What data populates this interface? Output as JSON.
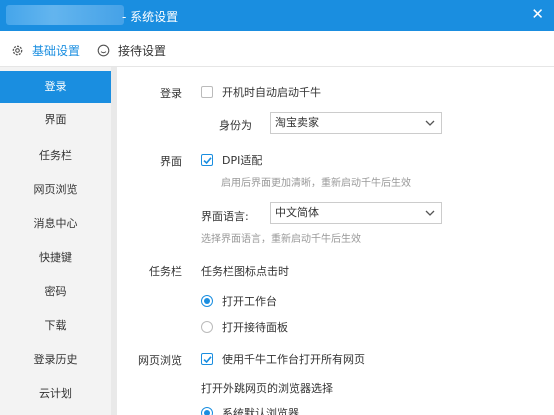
{
  "window": {
    "title": "- 系统设置",
    "close_label": "✕"
  },
  "tabs": [
    {
      "label": "基础设置",
      "icon": "gear-icon",
      "active": true
    },
    {
      "label": "接待设置",
      "icon": "smile-icon",
      "active": false
    }
  ],
  "sidebar": {
    "items": [
      {
        "label": "登录",
        "active": true
      },
      {
        "label": "界面"
      },
      {
        "label": "任务栏"
      },
      {
        "label": "网页浏览"
      },
      {
        "label": "消息中心"
      },
      {
        "label": "快捷键"
      },
      {
        "label": "密码"
      },
      {
        "label": "下载"
      },
      {
        "label": "登录历史"
      },
      {
        "label": "云计划"
      }
    ]
  },
  "login": {
    "section_label": "登录",
    "autostart_label": "开机时自动启动千牛",
    "autostart_checked": false,
    "identity_label": "身份为",
    "identity_value": "淘宝卖家"
  },
  "interface": {
    "section_label": "界面",
    "dpi_label": "DPI适配",
    "dpi_checked": true,
    "dpi_hint": "启用后界面更加清晰，重新启动千牛后生效",
    "language_label": "界面语言:",
    "language_value": "中文简体",
    "language_hint": "选择界面语言，重新启动千牛后生效"
  },
  "taskbar": {
    "section_label": "任务栏",
    "click_label": "任务栏图标点击时",
    "options": [
      {
        "label": "打开工作台",
        "selected": true
      },
      {
        "label": "打开接待面板",
        "selected": false
      }
    ]
  },
  "browser": {
    "section_label": "网页浏览",
    "use_workbench_label": "使用千牛工作台打开所有网页",
    "use_workbench_checked": true,
    "external_label": "打开外跳网页的浏览器选择",
    "default_browser_label": "系统默认浏览器",
    "default_browser_selected": true
  },
  "colors": {
    "accent": "#1a8ee0",
    "sidebar_bg": "#f3f3f3",
    "hint": "#999999"
  }
}
